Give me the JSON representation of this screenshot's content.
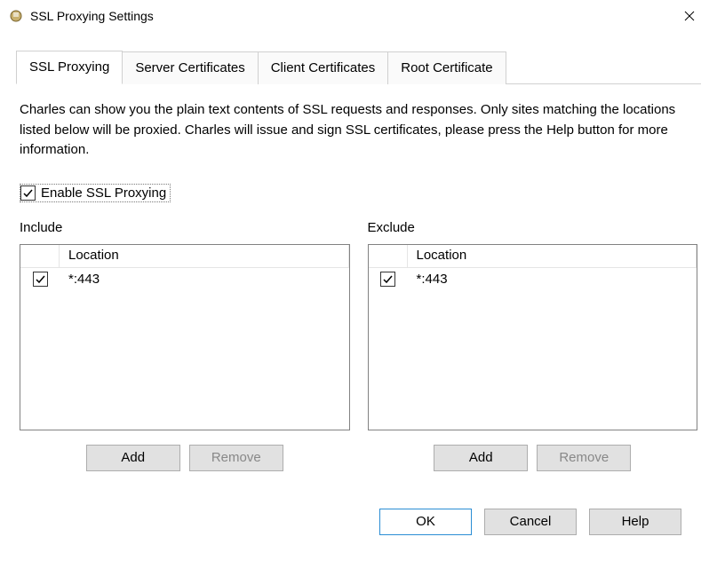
{
  "window": {
    "title": "SSL Proxying Settings"
  },
  "tabs": {
    "ssl_proxying": "SSL Proxying",
    "server_certificates": "Server Certificates",
    "client_certificates": "Client Certificates",
    "root_certificate": "Root Certificate"
  },
  "description": "Charles can show you the plain text contents of SSL requests and responses. Only sites matching the locations listed below will be proxied. Charles will issue and sign SSL certificates, please press the Help button for more information.",
  "enable_label": "Enable SSL Proxying",
  "enable_checked": true,
  "include": {
    "label": "Include",
    "header": "Location",
    "items": [
      {
        "checked": true,
        "location": "*:443"
      }
    ],
    "add_label": "Add",
    "remove_label": "Remove"
  },
  "exclude": {
    "label": "Exclude",
    "header": "Location",
    "items": [
      {
        "checked": true,
        "location": "*:443"
      }
    ],
    "add_label": "Add",
    "remove_label": "Remove"
  },
  "buttons": {
    "ok": "OK",
    "cancel": "Cancel",
    "help": "Help"
  }
}
